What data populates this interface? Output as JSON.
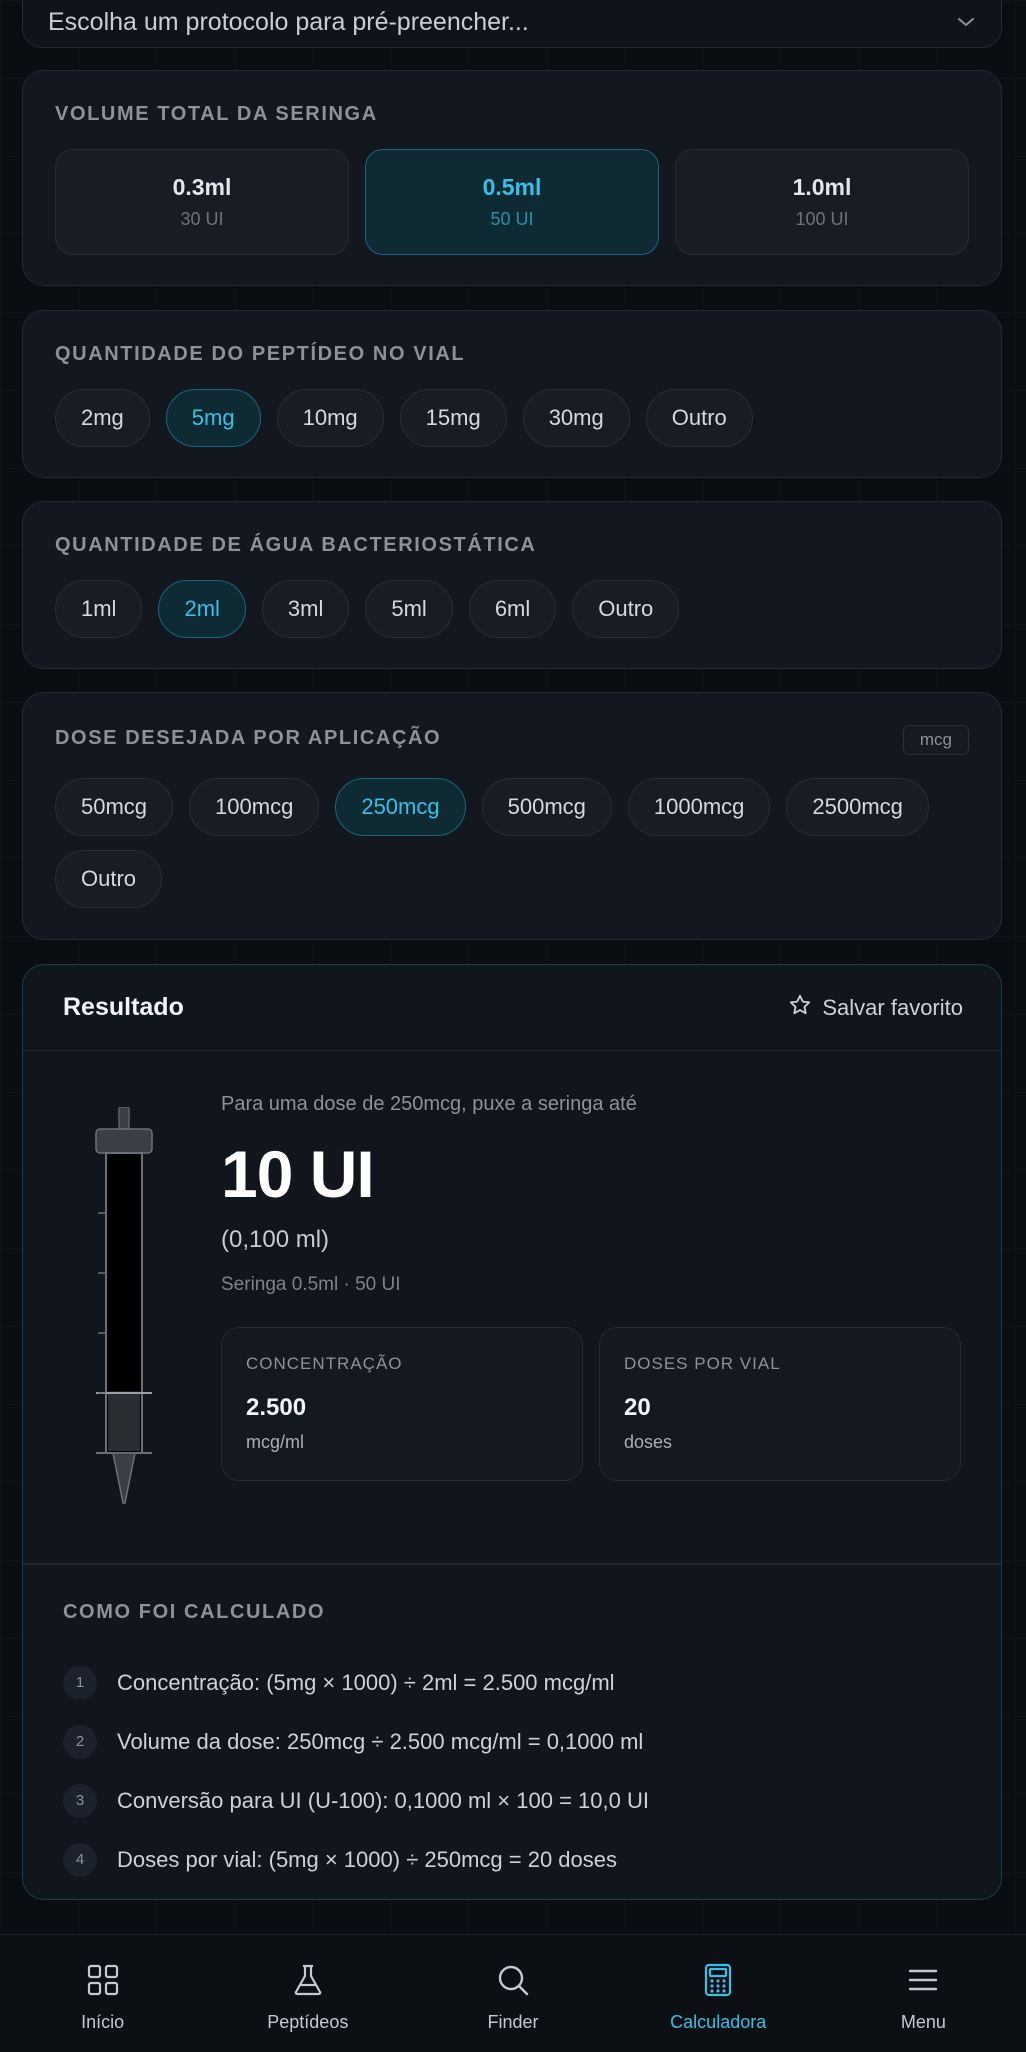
{
  "protocol": {
    "placeholder": "Escolha um protocolo para pré-preencher..."
  },
  "syringe_volume": {
    "title": "VOLUME TOTAL DA SERINGA",
    "options": [
      {
        "main": "0.3ml",
        "sub": "30 UI",
        "selected": false
      },
      {
        "main": "0.5ml",
        "sub": "50 UI",
        "selected": true
      },
      {
        "main": "1.0ml",
        "sub": "100 UI",
        "selected": false
      }
    ]
  },
  "peptide_qty": {
    "title": "QUANTIDADE DO PEPTÍDEO NO VIAL",
    "options": [
      "2mg",
      "5mg",
      "10mg",
      "15mg",
      "30mg",
      "Outro"
    ],
    "selected": "5mg"
  },
  "water_qty": {
    "title": "QUANTIDADE DE ÁGUA BACTERIOSTÁTICA",
    "options": [
      "1ml",
      "2ml",
      "3ml",
      "5ml",
      "6ml",
      "Outro"
    ],
    "selected": "2ml"
  },
  "dose": {
    "title": "DOSE DESEJADA POR APLICAÇÃO",
    "unit": "mcg",
    "options": [
      "50mcg",
      "100mcg",
      "250mcg",
      "500mcg",
      "1000mcg",
      "2500mcg",
      "Outro"
    ],
    "selected": "250mcg"
  },
  "result": {
    "title": "Resultado",
    "save_label": "Salvar favorito",
    "pre_text": "Para uma dose de 250mcg, puxe a seringa até",
    "big_value": "10 UI",
    "ml_value": "(0,100 ml)",
    "syringe_info": "Seringa 0.5ml · 50 UI",
    "fill_fraction": 0.2,
    "stats": [
      {
        "label": "CONCENTRAÇÃO",
        "value": "2.500",
        "unit": "mcg/ml"
      },
      {
        "label": "DOSES POR VIAL",
        "value": "20",
        "unit": "doses"
      }
    ],
    "calc_title": "COMO FOI CALCULADO",
    "steps": [
      {
        "n": "1",
        "text": "Concentração: (5mg × 1000) ÷ 2ml = 2.500 mcg/ml"
      },
      {
        "n": "2",
        "text": "Volume da dose: 250mcg ÷ 2.500 mcg/ml = 0,1000 ml"
      },
      {
        "n": "3",
        "text": "Conversão para UI (U-100): 0,1000 ml × 100 = 10,0 UI"
      },
      {
        "n": "4",
        "text": "Doses por vial: (5mg × 1000) ÷ 250mcg = 20 doses"
      }
    ]
  },
  "nav": {
    "items": [
      {
        "label": "Início",
        "icon": "grid-icon",
        "active": false
      },
      {
        "label": "Peptídeos",
        "icon": "flask-icon",
        "active": false
      },
      {
        "label": "Finder",
        "icon": "search-icon",
        "active": false
      },
      {
        "label": "Calculadora",
        "icon": "calculator-icon",
        "active": true
      },
      {
        "label": "Menu",
        "icon": "menu-icon",
        "active": false
      }
    ]
  },
  "colors": {
    "accent": "#39c0e6",
    "background": "#0a0d11",
    "card": "#131820"
  }
}
